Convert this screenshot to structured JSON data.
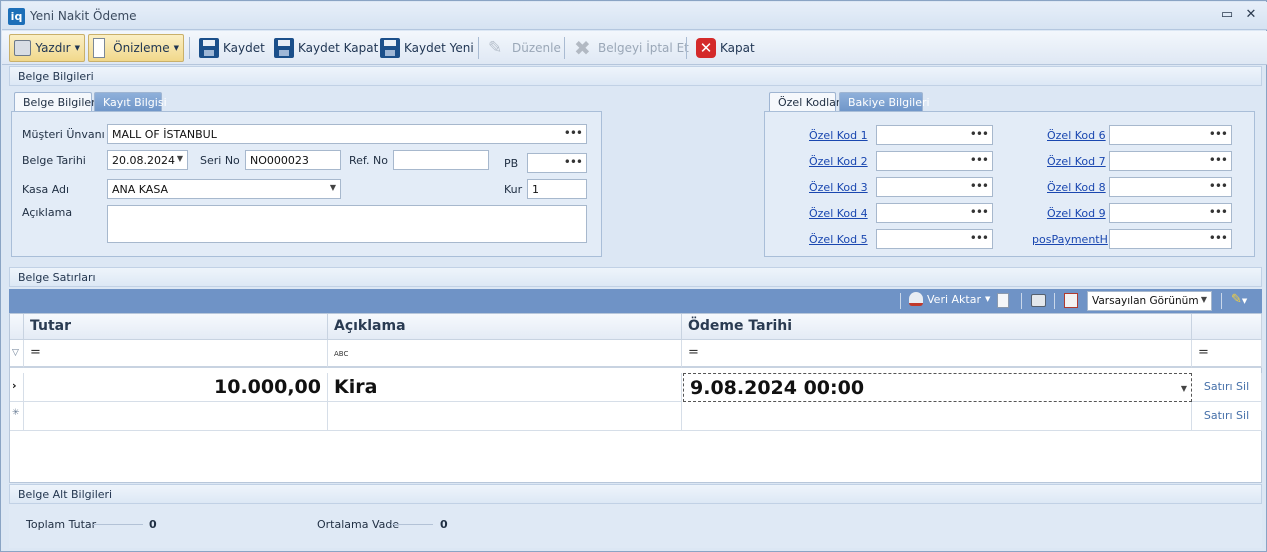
{
  "window": {
    "title": "Yeni Nakit Ödeme",
    "logo": "iq",
    "min_glyph": "▭",
    "close_glyph": "✕"
  },
  "toolbar": {
    "print": "Yazdır",
    "preview": "Önizleme",
    "save": "Kaydet",
    "save_close": "Kaydet Kapat",
    "save_new": "Kaydet Yeni",
    "edit": "Düzenle",
    "cancel_doc": "Belgeyi İptal Et",
    "close": "Kapat"
  },
  "sections": {
    "info": "Belge Bilgileri",
    "lines": "Belge Satırları",
    "footer": "Belge Alt Bilgileri"
  },
  "left_tabs": [
    "Belge Bilgileri",
    "Kayıt Bilgisi"
  ],
  "right_tabs": [
    "Özel Kodlar",
    "Bakiye Bilgileri"
  ],
  "form": {
    "customer_label": "Müşteri Ünvanı",
    "customer_value": "MALL OF İSTANBUL",
    "date_label": "Belge Tarihi",
    "date_value": "20.08.2024",
    "serial_label": "Seri No",
    "serial_value": "NO000023",
    "ref_label": "Ref. No",
    "ref_value": "",
    "pb_label": "PB",
    "pb_value": "",
    "cash_label": "Kasa Adı",
    "cash_value": "ANA KASA",
    "rate_label": "Kur",
    "rate_value": "1",
    "desc_label": "Açıklama",
    "desc_value": ""
  },
  "special_codes": [
    {
      "label": "Özel Kod 1",
      "value": ""
    },
    {
      "label": "Özel Kod 2",
      "value": ""
    },
    {
      "label": "Özel Kod 3",
      "value": ""
    },
    {
      "label": "Özel Kod 4",
      "value": ""
    },
    {
      "label": "Özel Kod 5",
      "value": ""
    },
    {
      "label": "Özel Kod 6",
      "value": ""
    },
    {
      "label": "Özel Kod 7",
      "value": ""
    },
    {
      "label": "Özel Kod 8",
      "value": ""
    },
    {
      "label": "Özel Kod 9",
      "value": ""
    },
    {
      "label": "posPaymentH",
      "value": ""
    }
  ],
  "grid_toolbar": {
    "export": "Veri Aktar",
    "view": "Varsayılan Görünüm"
  },
  "grid": {
    "columns": [
      "Tutar",
      "Açıklama",
      "Ödeme Tarihi"
    ],
    "filters": [
      "=",
      "ABC",
      "=",
      "="
    ],
    "rows": [
      {
        "amount": "10.000,00",
        "desc": "Kira",
        "date": "9.08.2024 00:00",
        "action": "Satırı Sil"
      },
      {
        "amount": "",
        "desc": "",
        "date": "",
        "action": "Satırı Sil"
      }
    ]
  },
  "footer": {
    "total_label": "Toplam Tutar",
    "total_value": "0",
    "avg_label": "Ortalama Vade",
    "avg_value": "0"
  }
}
